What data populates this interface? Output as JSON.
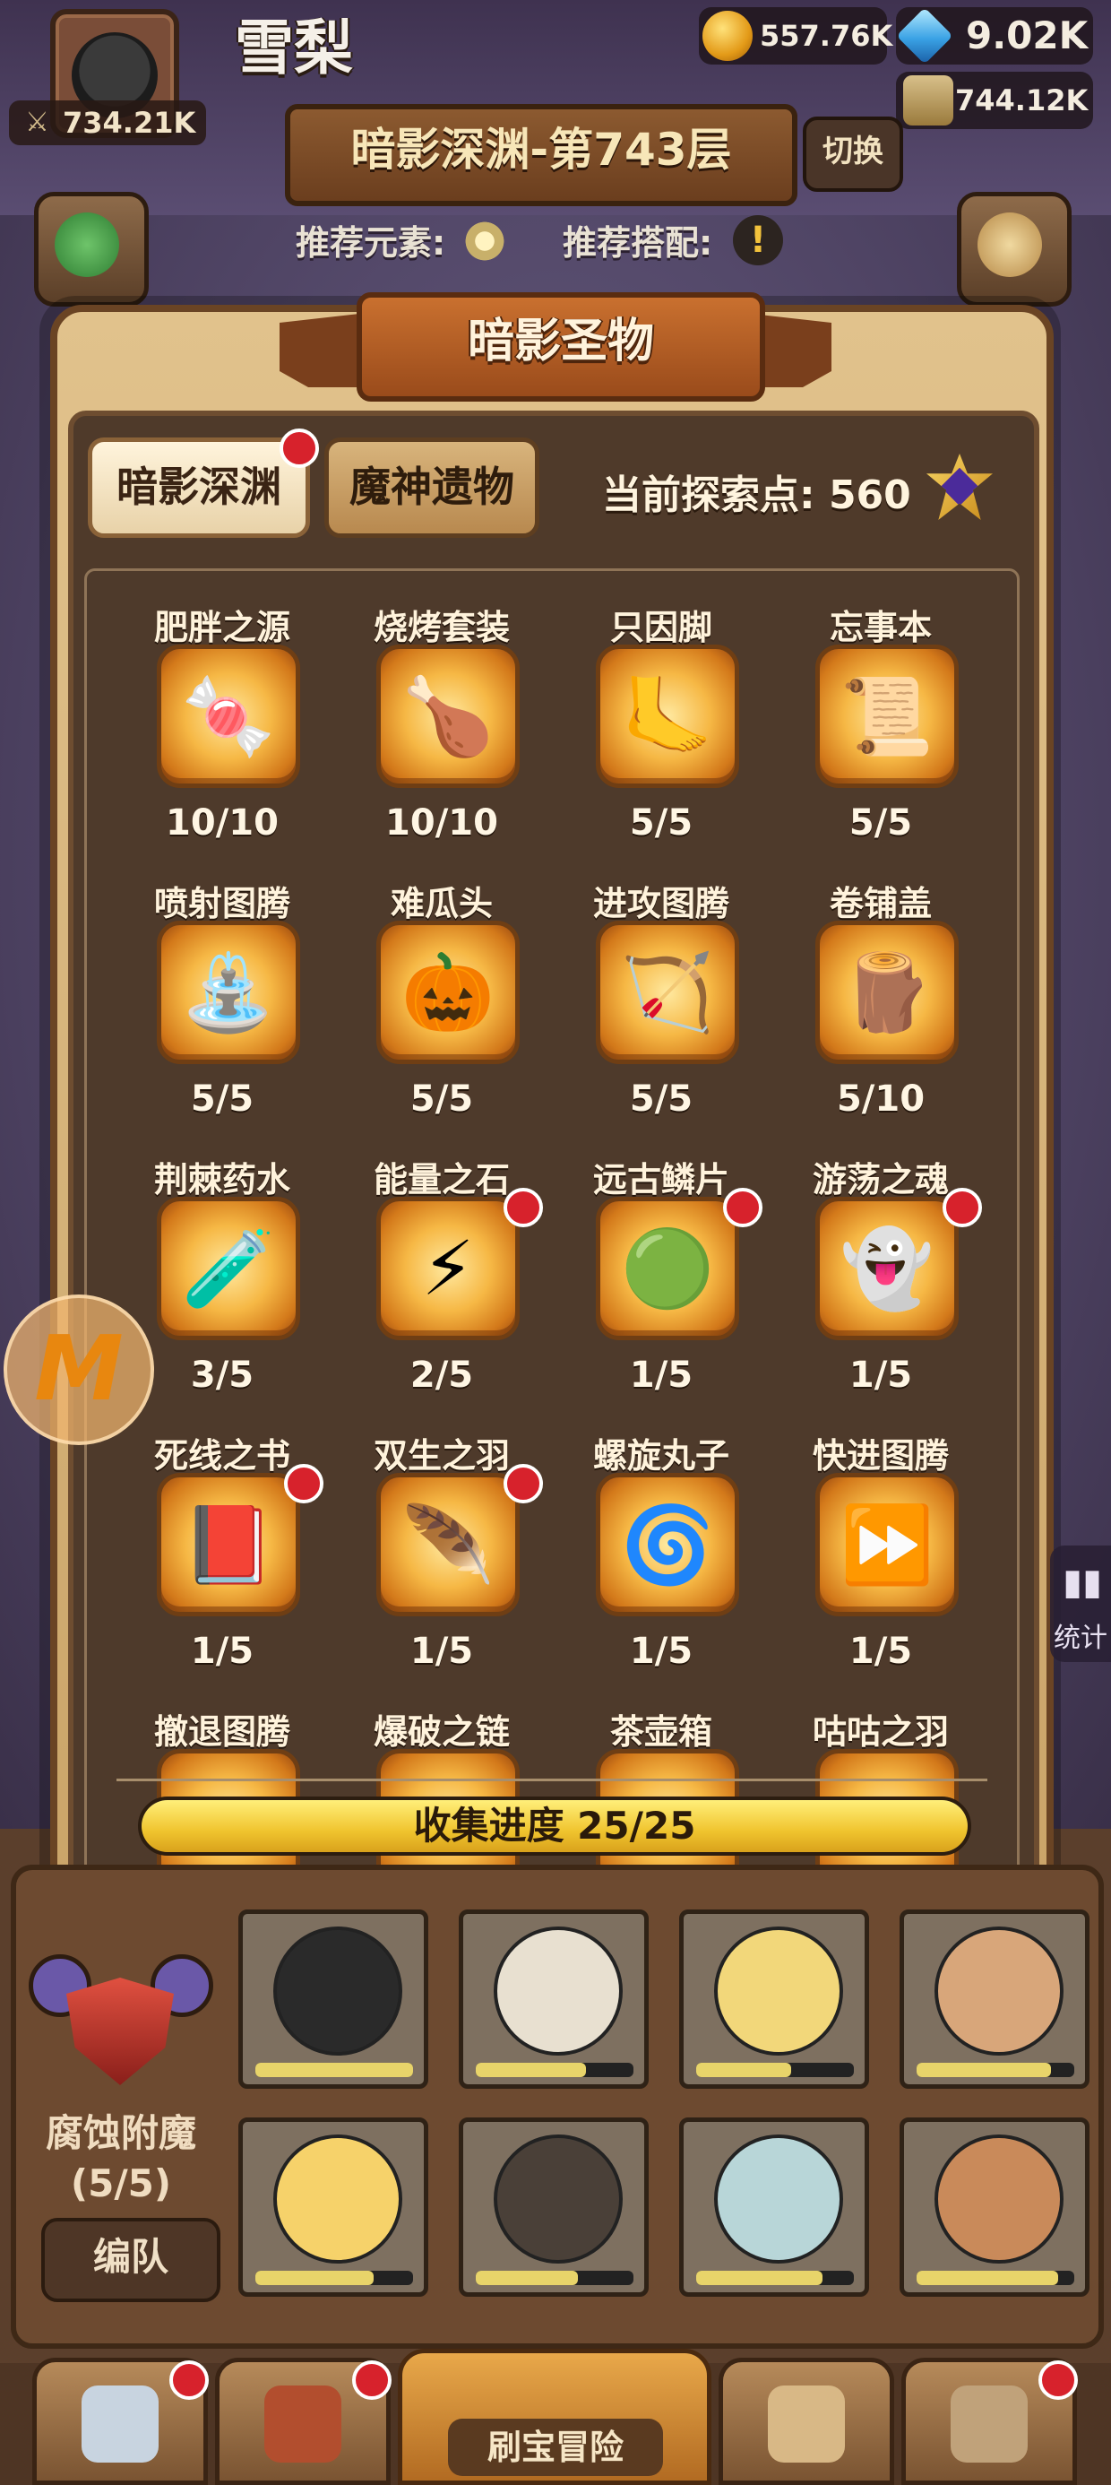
{
  "header": {
    "player_name": "雪梨",
    "power": "734.21K",
    "gold": "557.76K",
    "gems": "9.02K",
    "jars": "744.12K",
    "floor_title": "暗影深渊-第743层",
    "switch_label": "切换",
    "recommend_element_label": "推荐元素:",
    "recommend_combo_label": "推荐搭配:"
  },
  "dialog": {
    "title": "暗影圣物",
    "tabs": [
      {
        "label": "暗影深渊",
        "active": true,
        "badge": true
      },
      {
        "label": "魔神遗物",
        "active": false,
        "badge": false
      }
    ],
    "explore_label": "当前探索点:",
    "explore_points": "560",
    "items": [
      {
        "name": "肥胖之源",
        "count": "10/10",
        "icon": "candy-icon",
        "glyph": "🍬",
        "badge": false
      },
      {
        "name": "烧烤套装",
        "count": "10/10",
        "icon": "bbq-bucket-icon",
        "glyph": "🍗",
        "badge": false
      },
      {
        "name": "只因脚",
        "count": "5/5",
        "icon": "chicken-foot-icon",
        "glyph": "🦶",
        "badge": false
      },
      {
        "name": "忘事本",
        "count": "5/5",
        "icon": "scroll-icon",
        "glyph": "📜",
        "badge": false
      },
      {
        "name": "喷射图腾",
        "count": "5/5",
        "icon": "fountain-totem-icon",
        "glyph": "⛲",
        "badge": false
      },
      {
        "name": "难瓜头",
        "count": "5/5",
        "icon": "pumpkin-icon",
        "glyph": "🎃",
        "badge": false
      },
      {
        "name": "进攻图腾",
        "count": "5/5",
        "icon": "arrows-icon",
        "glyph": "🏹",
        "badge": false
      },
      {
        "name": "卷铺盖",
        "count": "5/10",
        "icon": "bedroll-icon",
        "glyph": "🪵",
        "badge": false
      },
      {
        "name": "荆棘药水",
        "count": "3/5",
        "icon": "potion-icon",
        "glyph": "🧪",
        "badge": false
      },
      {
        "name": "能量之石",
        "count": "2/5",
        "icon": "energy-stone-icon",
        "glyph": "⚡",
        "badge": true
      },
      {
        "name": "远古鳞片",
        "count": "1/5",
        "icon": "scales-icon",
        "glyph": "🟢",
        "badge": true
      },
      {
        "name": "游荡之魂",
        "count": "1/5",
        "icon": "ghost-icon",
        "glyph": "👻",
        "badge": true
      },
      {
        "name": "死线之书",
        "count": "1/5",
        "icon": "book-quill-icon",
        "glyph": "📕",
        "badge": true
      },
      {
        "name": "双生之羽",
        "count": "1/5",
        "icon": "feathers-icon",
        "glyph": "🪶",
        "badge": true
      },
      {
        "name": "螺旋丸子",
        "count": "1/5",
        "icon": "spiral-orb-icon",
        "glyph": "🌀",
        "badge": false
      },
      {
        "name": "快进图腾",
        "count": "1/5",
        "icon": "fast-forward-icon",
        "glyph": "⏩",
        "badge": false
      },
      {
        "name": "撤退图腾",
        "count": "",
        "icon": "retreat-totem-icon",
        "glyph": "",
        "badge": false
      },
      {
        "name": "爆破之链",
        "count": "",
        "icon": "blast-chain-icon",
        "glyph": "",
        "badge": false
      },
      {
        "name": "茶壶箱",
        "count": "",
        "icon": "teapot-box-icon",
        "glyph": "",
        "badge": false
      },
      {
        "name": "咕咕之羽",
        "count": "",
        "icon": "coo-feather-icon",
        "glyph": "",
        "badge": false
      }
    ],
    "progress_label": "收集进度 25/25",
    "progress_fraction": 1.0
  },
  "team": {
    "enchant_name": "腐蚀附魔",
    "enchant_progress": "(5/5)",
    "formation_label": "编队"
  },
  "side": {
    "stats_label": "统计"
  },
  "nav": {
    "center_label": "刷宝冒险"
  }
}
